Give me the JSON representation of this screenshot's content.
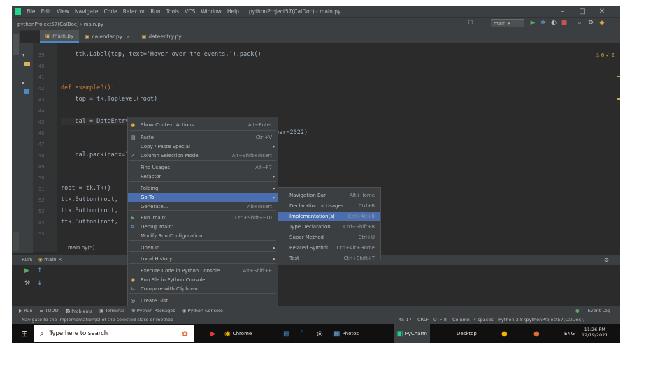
{
  "titlebar": {
    "menu": [
      "File",
      "Edit",
      "View",
      "Navigate",
      "Code",
      "Refactor",
      "Run",
      "Tools",
      "VCS",
      "Window",
      "Help"
    ],
    "title": "pythonProject57(CalDoc) - main.py"
  },
  "navbar": {
    "breadcrumb": "pythonProject57(CalDoc)  ›  main.py",
    "run_config": "main"
  },
  "tabs": [
    "main.py",
    "calendar.py",
    "dateentry.py"
  ],
  "editor": {
    "line_numbers": [
      "39",
      "40",
      "41",
      "42",
      "43",
      "44",
      "45",
      "46",
      "47",
      "48",
      "49",
      "50",
      "51",
      "52",
      "53",
      "54",
      "55"
    ],
    "code_lines": [
      "    ttk.Label(top, text='Hover over the events.').pack()",
      "",
      "",
      "def example3():",
      "    top = tk.Toplevel(root)",
      "",
      "    cal = DateEntry(top, width=12, background='darkblue',",
      "                                                  month=2, year=2022)",
      "",
      "    cal.pack(padx=10, pady=10)",
      "",
      "",
      "root = tk.Tk()",
      "ttk.Button(root,                              ).pack(padx=10, pady=10)",
      "ttk.Button(root,                                                )",
      "ttk.Button(root,",
      "",
      "root.mainloop()"
    ],
    "inspection": "⚠ 6  ✓ 2"
  },
  "context_menu": {
    "items": [
      {
        "label": "Show Context Actions",
        "shortcut": "Alt+Enter",
        "icon": "bulb-icon"
      },
      {
        "label": "Paste",
        "shortcut": "Ctrl+V",
        "icon": "paste-icon"
      },
      {
        "label": "Copy / Paste Special",
        "shortcut": "",
        "submenu": true
      },
      {
        "label": "Column Selection Mode",
        "shortcut": "Alt+Shift+Insert",
        "icon": "check-icon"
      },
      {
        "label": "Find Usages",
        "shortcut": "Alt+F7"
      },
      {
        "label": "Refactor",
        "shortcut": "",
        "submenu": true
      },
      {
        "label": "Folding",
        "shortcut": "",
        "submenu": true
      },
      {
        "label": "Go To",
        "shortcut": "",
        "submenu": true,
        "selected": true
      },
      {
        "label": "Generate...",
        "shortcut": "Alt+Insert"
      },
      {
        "label": "Run 'main'",
        "shortcut": "Ctrl+Shift+F10",
        "icon": "run-icon"
      },
      {
        "label": "Debug 'main'",
        "shortcut": "",
        "icon": "debug-icon"
      },
      {
        "label": "Modify Run Configuration...",
        "shortcut": ""
      },
      {
        "label": "Open In",
        "shortcut": "",
        "submenu": true
      },
      {
        "label": "Local History",
        "shortcut": "",
        "submenu": true
      },
      {
        "label": "Execute Code in Python Console",
        "shortcut": "Alt+Shift+E"
      },
      {
        "label": "Run File in Python Console",
        "shortcut": "",
        "icon": "python-icon"
      },
      {
        "label": "Compare with Clipboard",
        "shortcut": "",
        "icon": "compare-icon"
      },
      {
        "label": "Create Gist...",
        "shortcut": "",
        "icon": "github-icon"
      }
    ]
  },
  "goto_submenu": {
    "items": [
      {
        "label": "Navigation Bar",
        "shortcut": "Alt+Home"
      },
      {
        "label": "Declaration or Usages",
        "shortcut": "Ctrl+B"
      },
      {
        "label": "Implementation(s)",
        "shortcut": "Ctrl+Alt+B",
        "selected": true
      },
      {
        "label": "Type Declaration",
        "shortcut": "Ctrl+Shift+B"
      },
      {
        "label": "Super Method",
        "shortcut": "Ctrl+U"
      },
      {
        "label": "Related Symbol...",
        "shortcut": "Ctrl+Alt+Home"
      },
      {
        "label": "Test",
        "shortcut": "Ctrl+Shift+T"
      }
    ]
  },
  "run_panel": {
    "label": "Run:",
    "config": "main",
    "output": "main.py(5)"
  },
  "bottom_tools": [
    "▶ Run",
    "☰ TODO",
    "⓿ Problems",
    "▣ Terminal",
    "⚙ Python Packages",
    "◉ Python Console"
  ],
  "event_log": "Event Log",
  "status": {
    "message": "Navigate to the implementation(s) of the selected class or method",
    "position": "45:17",
    "line_sep": "CRLF",
    "encoding": "UTF-8",
    "column": "Column",
    "indent": "4 spaces",
    "interpreter": "Python 3.8 (pythonProject57(CalDoc))"
  },
  "taskbar": {
    "search_placeholder": "Type here to search",
    "apps": [
      "Chrome",
      "Files",
      "Photos",
      "PyCharm"
    ],
    "desktop": "Desktop",
    "time": "11:26 PM",
    "date": "12/19/2021",
    "lang": "ENG"
  }
}
